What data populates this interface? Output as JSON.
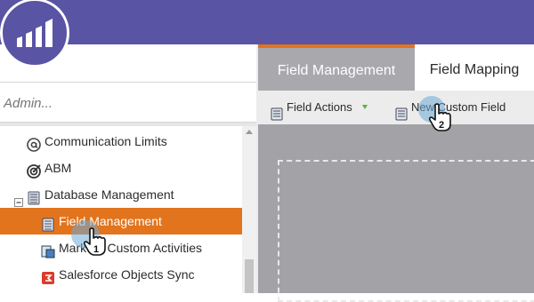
{
  "sidebar": {
    "search": {
      "placeholder": "Admin..."
    },
    "items": [
      {
        "label": "Communication Limits",
        "icon": "at-sign-icon"
      },
      {
        "label": "ABM",
        "icon": "target-icon"
      },
      {
        "label": "Database Management",
        "icon": "database-icon"
      },
      {
        "label": "Field Management",
        "icon": "field-list-icon",
        "selected": true
      },
      {
        "label": "Marketo Custom Activities",
        "icon": "custom-activity-icon"
      },
      {
        "label": "Salesforce Objects Sync",
        "icon": "salesforce-sync-icon"
      }
    ]
  },
  "tabs": [
    {
      "label": "Field Management",
      "active": true
    },
    {
      "label": "Field Mapping",
      "active": false
    }
  ],
  "toolbar": {
    "field_actions": "Field Actions",
    "new_custom_field": "New Custom Field"
  },
  "step_badges": {
    "one": "1",
    "two": "2"
  },
  "colors": {
    "brand_purple": "#5a54a4",
    "accent_orange": "#e2741d",
    "canvas_gray": "#a3a2a7"
  }
}
